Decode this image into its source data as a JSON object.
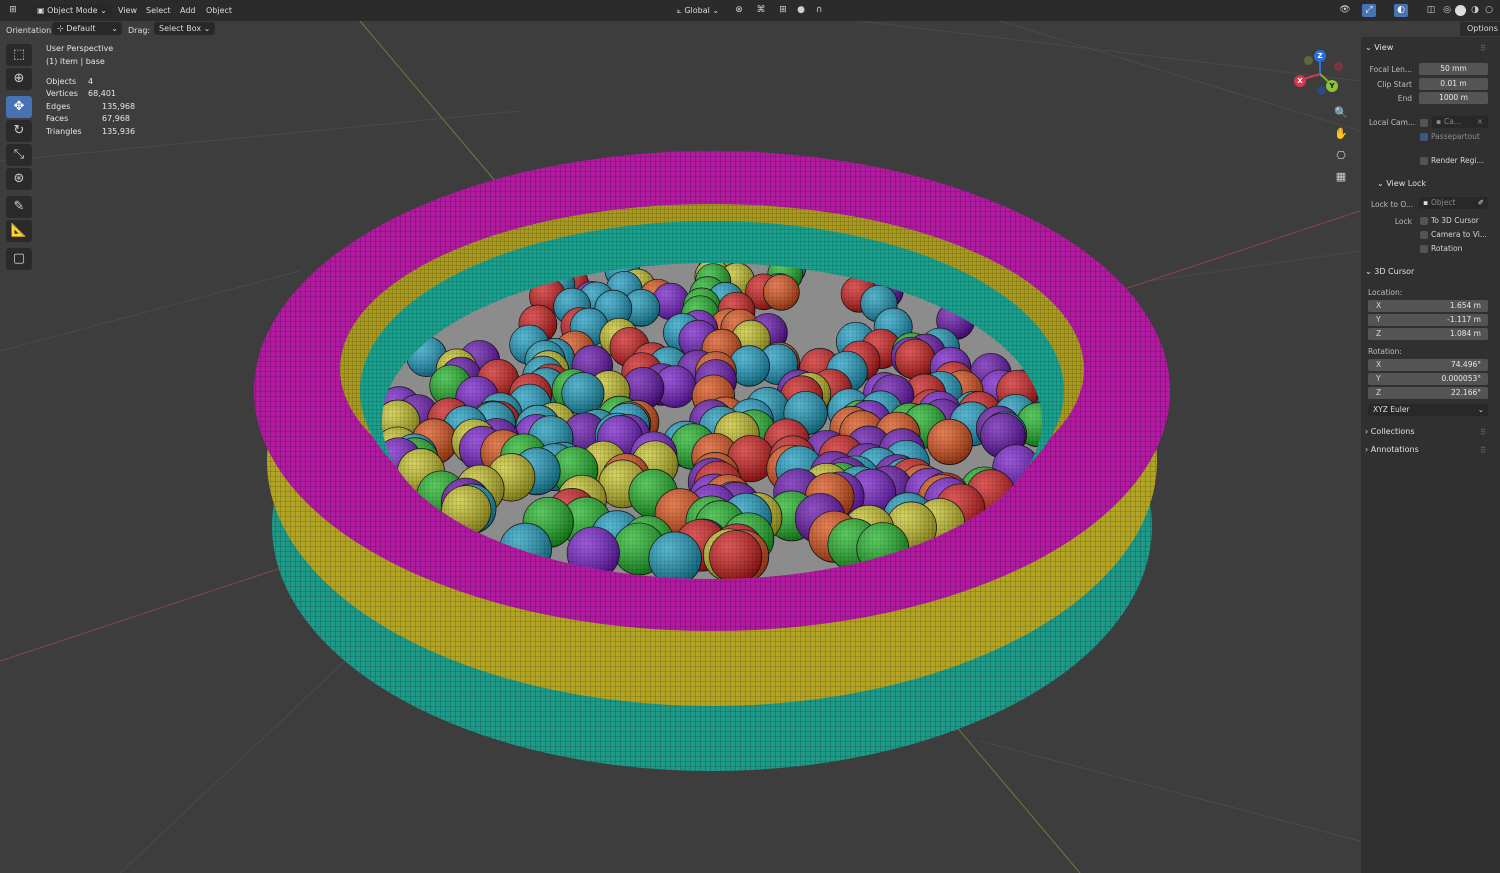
{
  "header": {
    "mode": "Object Mode",
    "menus": [
      "View",
      "Select",
      "Add",
      "Object"
    ],
    "transform_orientation": "Global"
  },
  "toolbar": {
    "orientation_label": "Orientation:",
    "orientation_value": "Default",
    "drag_label": "Drag:",
    "drag_value": "Select Box",
    "options_label": "Options"
  },
  "viewport": {
    "perspective": "User Perspective",
    "item": "(1) item | base",
    "stats": [
      {
        "label": "Objects",
        "value": "4"
      },
      {
        "label": "Vertices",
        "value": "68,401"
      },
      {
        "label": "Edges",
        "value": "135,968"
      },
      {
        "label": "Faces",
        "value": "67,968"
      },
      {
        "label": "Triangles",
        "value": "135,936"
      }
    ],
    "gizmo": {
      "z": "Z",
      "y": "Y",
      "x": "X"
    }
  },
  "sidebar": {
    "view": {
      "title": "View",
      "focal_label": "Focal Len...",
      "focal_value": "50 mm",
      "clip_start_label": "Clip Start",
      "clip_start_value": "0.01 m",
      "clip_end_label": "End",
      "clip_end_value": "1000 m",
      "local_cam_label": "Local Cam...",
      "local_cam_value": "Ca...",
      "passepartout": "Passepartout",
      "render_region": "Render Regi..."
    },
    "view_lock": {
      "title": "View Lock",
      "lock_to_label": "Lock to O...",
      "lock_to_placeholder": "Object",
      "lock_label": "Lock",
      "to_3d_cursor": "To 3D Cursor",
      "camera_to_view": "Camera to Vi...",
      "rotation": "Rotation"
    },
    "cursor": {
      "title": "3D Cursor",
      "location_label": "Location:",
      "loc_x": "1.654 m",
      "loc_y": "-1.117 m",
      "loc_z": "1.084 m",
      "rotation_label": "Rotation:",
      "rot_x": "74.496°",
      "rot_y": "0.000053°",
      "rot_z": "22.166°",
      "rotation_mode": "XYZ Euler",
      "axes": [
        "X",
        "Y",
        "Z"
      ]
    },
    "collections": "Collections",
    "annotations": "Annotations"
  },
  "colors": {
    "magenta": "#c81fb4",
    "yellow": "#c4b52a",
    "teal": "#22b6a0",
    "accent": "#4772b3"
  }
}
